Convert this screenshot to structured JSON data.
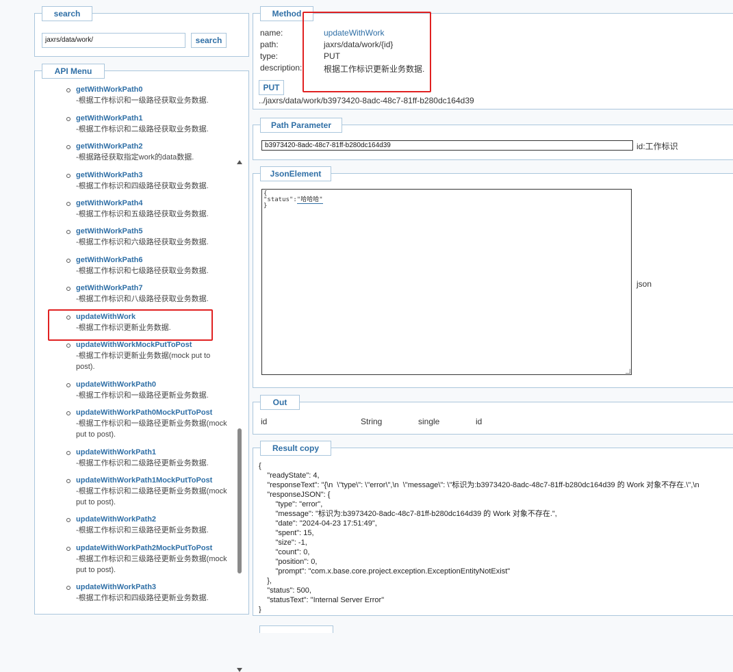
{
  "search": {
    "legend": "search",
    "input_value": "jaxrs/data/work/",
    "button_label": "search"
  },
  "api_menu": {
    "legend": "API Menu",
    "items": [
      {
        "name": "getWithWorkPath0",
        "desc": "-根据工作标识和一级路径获取业务数据."
      },
      {
        "name": "getWithWorkPath1",
        "desc": "-根据工作标识和二级路径获取业务数据."
      },
      {
        "name": "getWithWorkPath2",
        "desc": "-根据路径获取指定work的data数据."
      },
      {
        "name": "getWithWorkPath3",
        "desc": "-根据工作标识和四级路径获取业务数据."
      },
      {
        "name": "getWithWorkPath4",
        "desc": "-根据工作标识和五级路径获取业务数据."
      },
      {
        "name": "getWithWorkPath5",
        "desc": "-根据工作标识和六级路径获取业务数据."
      },
      {
        "name": "getWithWorkPath6",
        "desc": "-根据工作标识和七级路径获取业务数据."
      },
      {
        "name": "getWithWorkPath7",
        "desc": "-根据工作标识和八级路径获取业务数据."
      },
      {
        "name": "updateWithWork",
        "desc": "-根据工作标识更新业务数据."
      },
      {
        "name": "updateWithWorkMockPutToPost",
        "desc": "-根据工作标识更新业务数据(mock put to post)."
      },
      {
        "name": "updateWithWorkPath0",
        "desc": "-根据工作标识和一级路径更新业务数据."
      },
      {
        "name": "updateWithWorkPath0MockPutToPost",
        "desc": "-根据工作标识和一级路径更新业务数据(mock put to post)."
      },
      {
        "name": "updateWithWorkPath1",
        "desc": "-根据工作标识和二级路径更新业务数据."
      },
      {
        "name": "updateWithWorkPath1MockPutToPost",
        "desc": "-根据工作标识和二级路径更新业务数据(mock put to post)."
      },
      {
        "name": "updateWithWorkPath2",
        "desc": "-根据工作标识和三级路径更新业务数据."
      },
      {
        "name": "updateWithWorkPath2MockPutToPost",
        "desc": "-根据工作标识和三级路径更新业务数据(mock put to post)."
      },
      {
        "name": "updateWithWorkPath3",
        "desc": "-根据工作标识和四级路径更新业务数据."
      }
    ]
  },
  "method": {
    "legend": "Method",
    "name_label": "name:",
    "name_value": "updateWithWork",
    "path_label": "path:",
    "path_value": "jaxrs/data/work/{id}",
    "type_label": "type:",
    "type_value": "PUT",
    "description_label": "description:",
    "description_value": "根据工作标识更新业务数据.",
    "put_button": "PUT",
    "url": "../jaxrs/data/work/b3973420-8adc-48c7-81ff-b280dc164d39"
  },
  "path_parameter": {
    "legend": "Path Parameter",
    "value": "b3973420-8adc-48c7-81ff-b280dc164d39",
    "label": "id:工作标识"
  },
  "json_element": {
    "legend": "JsonElement",
    "text_line1": "{",
    "text_key": "\"status\":",
    "text_val": "\"哈哈哈\"",
    "text_line3": "}",
    "label": "json"
  },
  "out": {
    "legend": "Out",
    "cols": [
      "id",
      "String",
      "single",
      "id"
    ]
  },
  "result": {
    "legend": "Result copy",
    "text": "{\n    \"readyState\": 4,\n    \"responseText\": \"{\\n  \\\"type\\\": \\\"error\\\",\\n  \\\"message\\\": \\\"标识为:b3973420-8adc-48c7-81ff-b280dc164d39 的 Work 对象不存在.\\\",\\n\n    \"responseJSON\": {\n        \"type\": \"error\",\n        \"message\": \"标识为:b3973420-8adc-48c7-81ff-b280dc164d39 的 Work 对象不存在.\",\n        \"date\": \"2024-04-23 17:51:49\",\n        \"spent\": 15,\n        \"size\": -1,\n        \"count\": 0,\n        \"position\": 0,\n        \"prompt\": \"com.x.base.core.project.exception.ExceptionEntityNotExist\"\n    },\n    \"status\": 500,\n    \"statusText\": \"Internal Server Error\"\n}"
  },
  "colors": {
    "accent": "#2f6fa6",
    "border": "#aac6dc",
    "highlight": "#e02020"
  }
}
